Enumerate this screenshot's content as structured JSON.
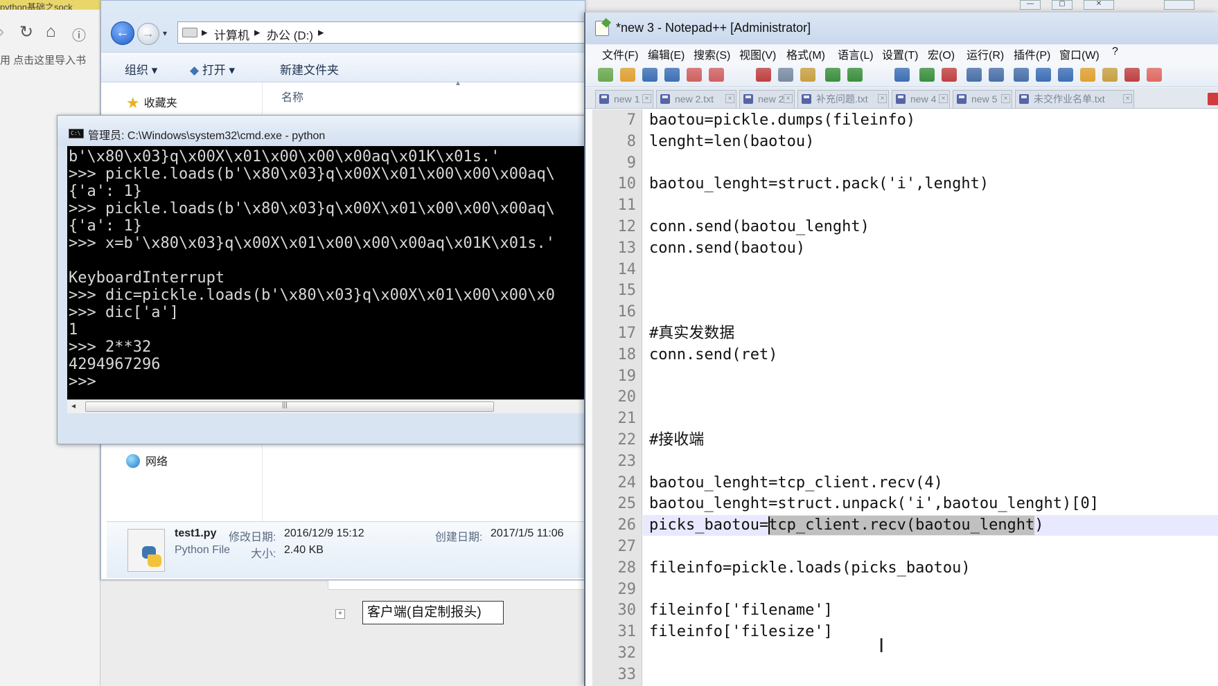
{
  "browser": {
    "tab_title": "python基础之sock",
    "bookmark_text": "用   点击这里导入书"
  },
  "explorer": {
    "breadcrumb": [
      "计算机",
      "办公 (D:)"
    ],
    "toolbar": {
      "organize": "组织 ▾",
      "open": "打开 ▾",
      "new_folder": "新建文件夹"
    },
    "favorites": "收藏夹",
    "column_name": "名称",
    "network": "网络",
    "details": {
      "filename": "test1.py",
      "filetype": "Python File",
      "modified_label": "修改日期:",
      "modified_value": "2016/12/9 15:12",
      "size_label": "大小:",
      "size_value": "2.40 KB",
      "created_label": "创建日期:",
      "created_value": "2017/1/5 11:06"
    }
  },
  "cmd": {
    "title": "管理员: C:\\Windows\\system32\\cmd.exe - python",
    "lines": [
      "b'\\x80\\x03}q\\x00X\\x01\\x00\\x00\\x00aq\\x01K\\x01s.'",
      ">>> pickle.loads(b'\\x80\\x03}q\\x00X\\x01\\x00\\x00\\x00aq\\",
      "{'a': 1}",
      ">>> pickle.loads(b'\\x80\\x03}q\\x00X\\x01\\x00\\x00\\x00aq\\",
      "{'a': 1}",
      ">>> x=b'\\x80\\x03}q\\x00X\\x01\\x00\\x00\\x00aq\\x01K\\x01s.'",
      "",
      "KeyboardInterrupt",
      ">>> dic=pickle.loads(b'\\x80\\x03}q\\x00X\\x01\\x00\\x00\\x0",
      ">>> dic['a']",
      "1",
      ">>> 2**32",
      "4294967296",
      ">>>"
    ]
  },
  "left_bottom": {
    "client_label": "客户端(自定制报头)"
  },
  "npp": {
    "title": "*new 3 - Notepad++ [Administrator]",
    "menu": [
      "文件(F)",
      "编辑(E)",
      "搜索(S)",
      "视图(V)",
      "格式(M)",
      "语言(L)",
      "设置(T)",
      "宏(O)",
      "运行(R)",
      "插件(P)",
      "窗口(W)",
      "?"
    ],
    "tabs": [
      "new 1",
      "new 2.txt",
      "new 2",
      "补充问题.txt",
      "new 4",
      "new 5",
      "未交作业名单.txt"
    ],
    "lines": [
      {
        "n": "7",
        "code": "baotou=pickle.dumps(fileinfo)"
      },
      {
        "n": "8",
        "code": "lenght=len(baotou)"
      },
      {
        "n": "9",
        "code": ""
      },
      {
        "n": "10",
        "code": "baotou_lenght=struct.pack('i',lenght)"
      },
      {
        "n": "11",
        "code": ""
      },
      {
        "n": "12",
        "code": "conn.send(baotou_lenght)"
      },
      {
        "n": "13",
        "code": "conn.send(baotou)"
      },
      {
        "n": "14",
        "code": ""
      },
      {
        "n": "15",
        "code": ""
      },
      {
        "n": "16",
        "code": ""
      },
      {
        "n": "17",
        "code": "#真实发数据"
      },
      {
        "n": "18",
        "code": "conn.send(ret)"
      },
      {
        "n": "19",
        "code": ""
      },
      {
        "n": "20",
        "code": ""
      },
      {
        "n": "21",
        "code": ""
      },
      {
        "n": "22",
        "code": "#接收端"
      },
      {
        "n": "23",
        "code": ""
      },
      {
        "n": "24",
        "code": "baotou_lenght=tcp_client.recv(4)"
      },
      {
        "n": "25",
        "code": "baotou_lenght=struct.unpack('i',baotou_lenght)[0]"
      },
      {
        "n": "26",
        "code": "picks_baotou=tcp_client.recv(baotou_lenght)"
      },
      {
        "n": "27",
        "code": ""
      },
      {
        "n": "28",
        "code": "fileinfo=pickle.loads(picks_baotou)"
      },
      {
        "n": "29",
        "code": ""
      },
      {
        "n": "30",
        "code": "fileinfo['filename']"
      },
      {
        "n": "31",
        "code": "fileinfo['filesize']"
      },
      {
        "n": "32",
        "code": ""
      },
      {
        "n": "33",
        "code": ""
      }
    ]
  }
}
